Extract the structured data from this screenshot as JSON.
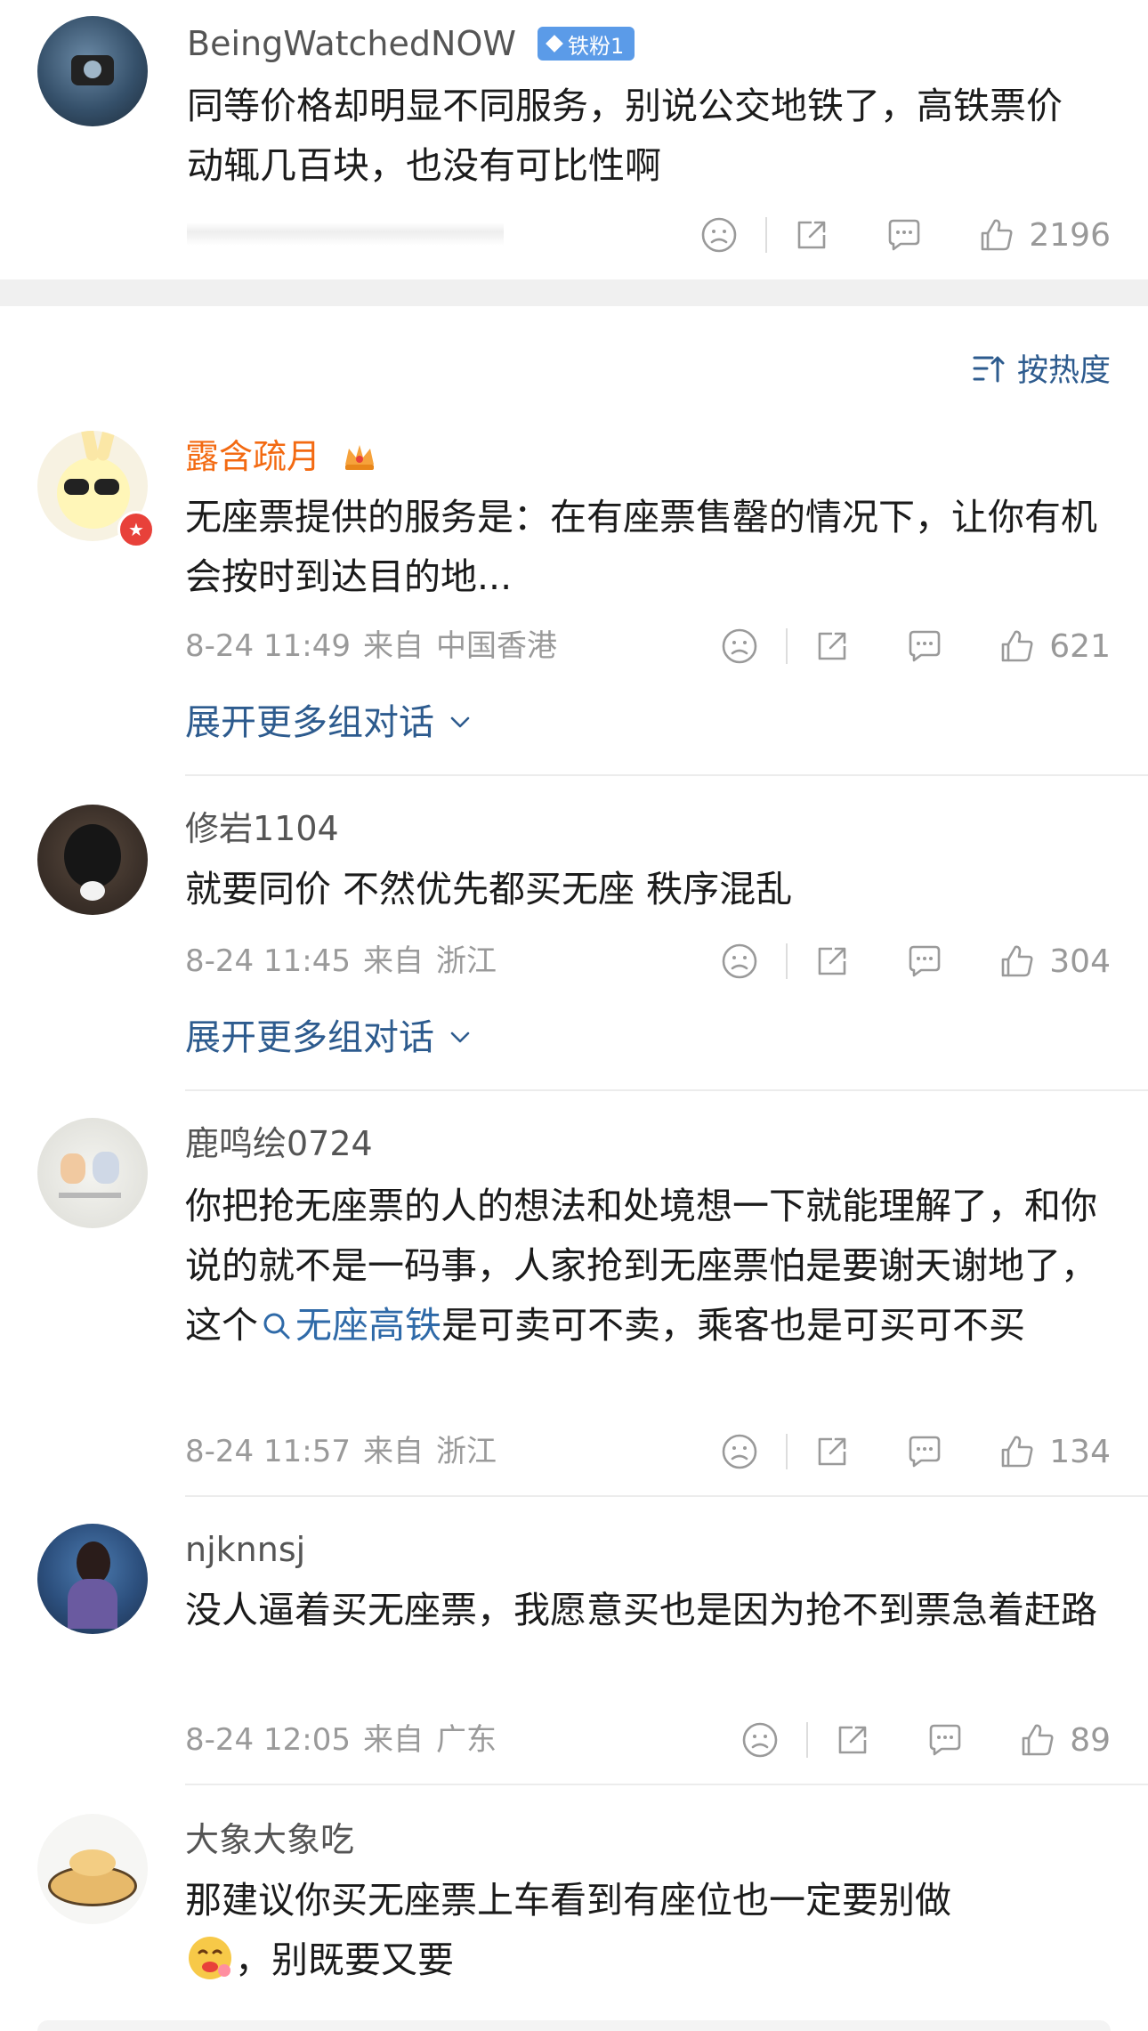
{
  "top_post": {
    "user": "BeingWatchedNOW",
    "badge": "铁粉1",
    "text": "同等价格却明显不同服务，别说公交地铁了，高铁票价动辄几百块，也没有可比性啊",
    "likes": "2196"
  },
  "sort": {
    "label": "按热度"
  },
  "expand_label": "展开更多组对话",
  "comments": [
    {
      "name": "露含疏月",
      "text": "无座票提供的服务是：在有座票售罄的情况下，让你有机会按时到达目的地...",
      "time": "8-24 11:49",
      "from": "来自",
      "location": "中国香港",
      "likes": "621"
    },
    {
      "name": "修岩1104",
      "text": "就要同价 不然优先都买无座 秩序混乱",
      "time": "8-24 11:45",
      "from": "来自",
      "location": "浙江",
      "likes": "304"
    },
    {
      "name": "鹿鸣绘0724",
      "text_before": "你把抢无座票的人的想法和处境想一下就能理解了，和你说的就不是一码事，人家抢到无座票怕是要谢天谢地了，这个",
      "link": "无座高铁",
      "text_after": "是可卖可不卖，乘客也是可买可不买",
      "time": "8-24 11:57",
      "from": "来自",
      "location": "浙江",
      "likes": "134"
    },
    {
      "name": "njknnsj",
      "text": "没人逼着买无座票，我愿意买也是因为抢不到票急着赶路",
      "time": "8-24 12:05",
      "from": "来自",
      "location": "广东",
      "likes": "89"
    },
    {
      "name": "大象大象吃",
      "text_before": "那建议你买无座票上车看到有座位也一定要别做",
      "text_after": "，别既要又要"
    }
  ],
  "colors": {
    "accent_link": "#2d5b8e",
    "vip_name": "#f36a12",
    "meta": "#9a9a9a"
  }
}
